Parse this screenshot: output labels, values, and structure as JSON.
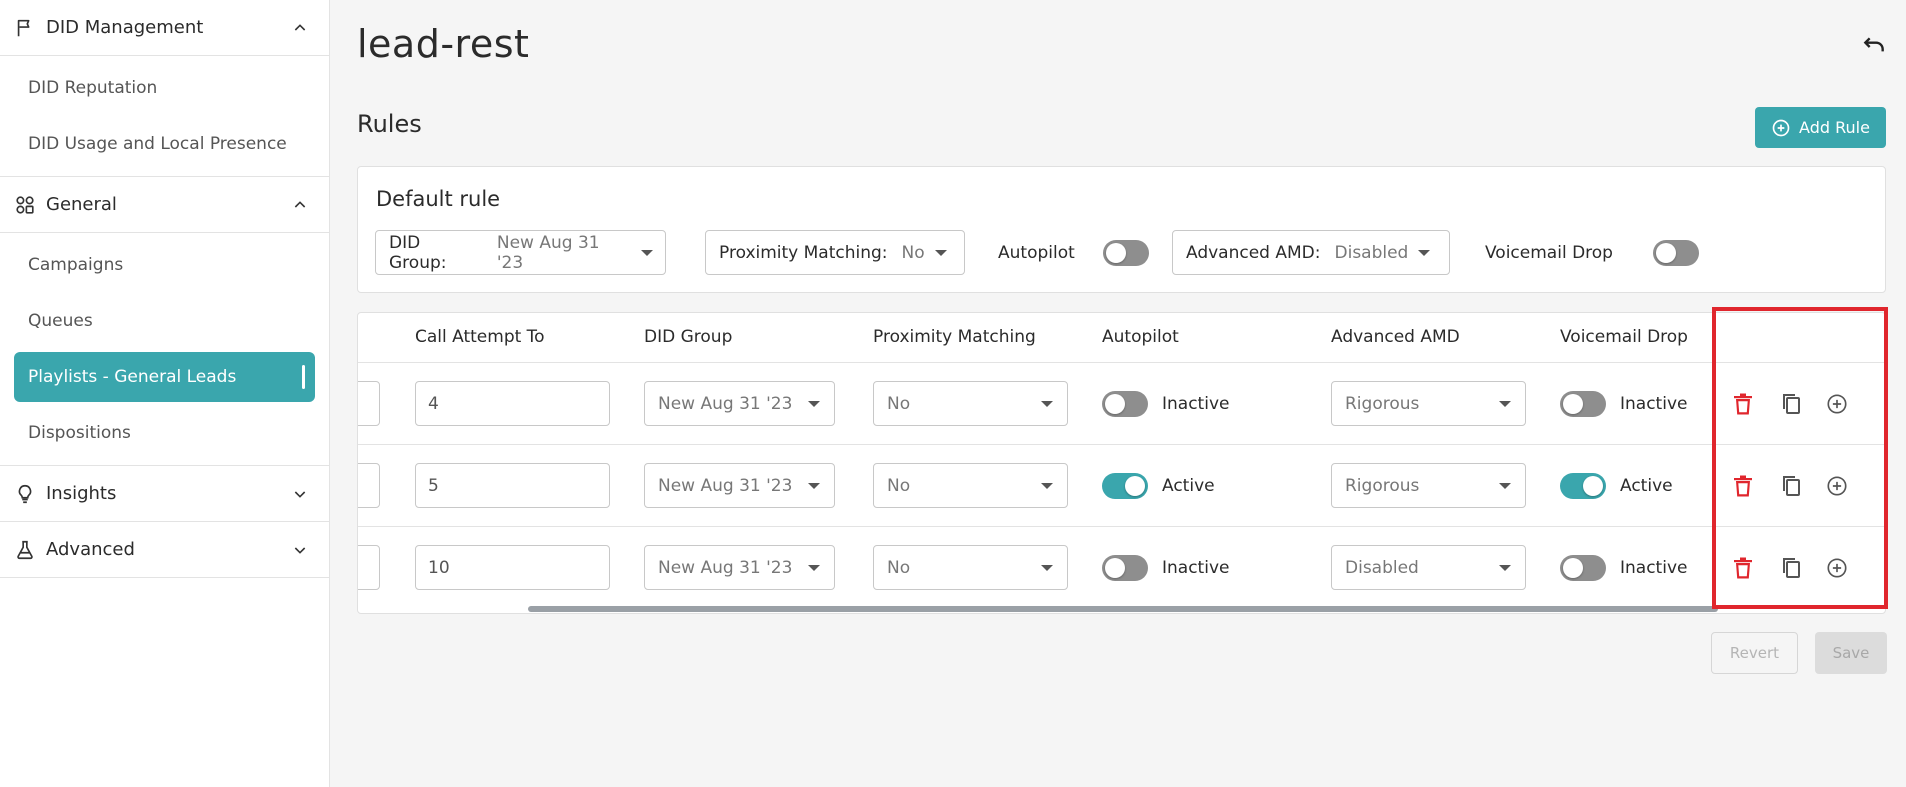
{
  "sidebar": {
    "sections": [
      {
        "label": "DID Management",
        "icon": "flag-icon",
        "expanded": true,
        "items": [
          "DID Reputation",
          "DID Usage and Local Presence"
        ]
      },
      {
        "label": "General",
        "icon": "apps-icon",
        "expanded": true,
        "items": [
          "Campaigns",
          "Queues",
          "Playlists - General Leads",
          "Dispositions"
        ],
        "active_item": "Playlists - General Leads"
      },
      {
        "label": "Insights",
        "icon": "lightbulb-icon",
        "expanded": false
      },
      {
        "label": "Advanced",
        "icon": "flask-icon",
        "expanded": false
      }
    ]
  },
  "page": {
    "title": "lead-rest",
    "undo_icon": "undo-icon"
  },
  "rules": {
    "title": "Rules",
    "add_rule_label": "Add Rule",
    "default_rule": {
      "title": "Default rule",
      "did_group_label": "DID Group:",
      "did_group_value": "New Aug 31 '23",
      "proximity_label": "Proximity Matching:",
      "proximity_value": "No",
      "autopilot_label": "Autopilot",
      "autopilot_on": false,
      "amd_label": "Advanced AMD:",
      "amd_value": "Disabled",
      "voicemail_label": "Voicemail Drop",
      "voicemail_on": false
    },
    "table": {
      "headers": [
        "Call Attempt To",
        "DID Group",
        "Proximity Matching",
        "Autopilot",
        "Advanced AMD",
        "Voicemail Drop"
      ],
      "rows": [
        {
          "attempt": "4",
          "did_group": "New Aug 31 '23",
          "proximity": "No",
          "autopilot": "Inactive",
          "autopilot_on": false,
          "amd": "Rigorous",
          "voicemail": "Inactive",
          "voicemail_on": false
        },
        {
          "attempt": "5",
          "did_group": "New Aug 31 '23",
          "proximity": "No",
          "autopilot": "Active",
          "autopilot_on": true,
          "amd": "Rigorous",
          "voicemail": "Active",
          "voicemail_on": true
        },
        {
          "attempt": "10",
          "did_group": "New Aug 31 '23",
          "proximity": "No",
          "autopilot": "Inactive",
          "autopilot_on": false,
          "amd": "Disabled",
          "voicemail": "Inactive",
          "voicemail_on": false
        }
      ],
      "row_action_icons": [
        "delete-icon",
        "copy-icon",
        "add-circle-icon"
      ]
    },
    "revert_label": "Revert",
    "save_label": "Save"
  },
  "colors": {
    "accent": "#3aa6ad",
    "danger": "#e0262d",
    "highlight": "#e0262d"
  }
}
